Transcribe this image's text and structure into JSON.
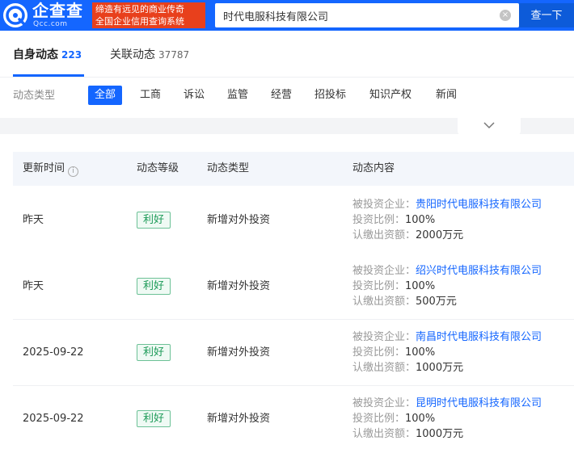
{
  "header": {
    "logo_text": "企查查",
    "logo_sub": "Qcc.com",
    "slogan_line1": "缔造有远见的商业传奇",
    "slogan_line2": "全国企业信用查询系统",
    "search_value": "时代电服科技有限公司",
    "clear_glyph": "×",
    "search_button": "查一下",
    "brand_color": "#1466ff"
  },
  "tabs": [
    {
      "label": "自身动态",
      "count": "223"
    },
    {
      "label": "关联动态",
      "count": "37787"
    }
  ],
  "filter": {
    "label": "动态类型",
    "options": [
      "全部",
      "工商",
      "诉讼",
      "监管",
      "经营",
      "招投标",
      "知识产权",
      "新闻"
    ]
  },
  "table": {
    "headers": [
      "更新时间",
      "动态等级",
      "动态类型",
      "动态内容"
    ],
    "info_glyph": "i",
    "field_labels": [
      "被投资企业：",
      "投资比例：",
      "认缴出资额："
    ],
    "rows": [
      {
        "time": "昨天",
        "level": "利好",
        "type": "新增对外投资",
        "company": "贵阳时代电服科技有限公司",
        "ratio": "100%",
        "amount": "2000万元"
      },
      {
        "time": "昨天",
        "level": "利好",
        "type": "新增对外投资",
        "company": "绍兴时代电服科技有限公司",
        "ratio": "100%",
        "amount": "500万元"
      },
      {
        "time": "2025-09-22",
        "level": "利好",
        "type": "新增对外投资",
        "company": "南昌时代电服科技有限公司",
        "ratio": "100%",
        "amount": "1000万元"
      },
      {
        "time": "2025-09-22",
        "level": "利好",
        "type": "新增对外投资",
        "company": "昆明时代电服科技有限公司",
        "ratio": "100%",
        "amount": "1000万元"
      }
    ]
  }
}
